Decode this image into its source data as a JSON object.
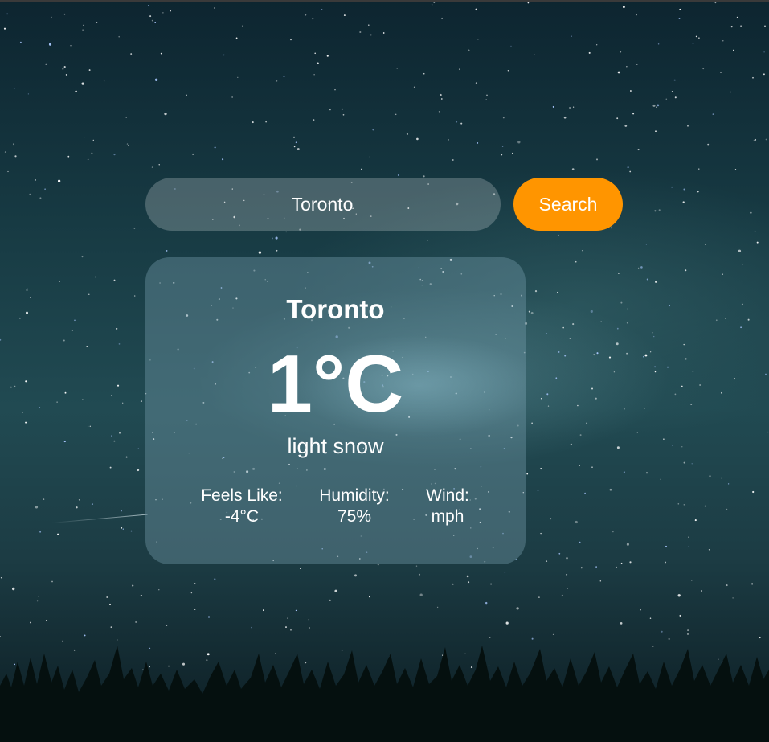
{
  "search": {
    "value": "Toronto",
    "button_label": "Search"
  },
  "weather": {
    "city": "Toronto",
    "temperature": "1°C",
    "description": "light snow",
    "feels_like": {
      "label": "Feels Like:",
      "value": "-4°C"
    },
    "humidity": {
      "label": "Humidity:",
      "value": "75%"
    },
    "wind": {
      "label": "Wind:",
      "value": "mph"
    }
  },
  "colors": {
    "accent": "#ff9500",
    "sky_dark": "#0d2530",
    "sky_mid": "#214a52",
    "text": "#ffffff"
  }
}
